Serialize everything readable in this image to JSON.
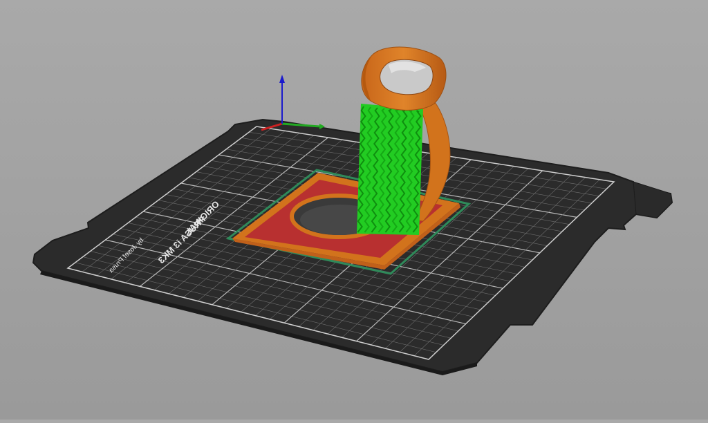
{
  "bed": {
    "brand_line1": "ORIGINAL",
    "brand_line2": "PRUSA i3 MK3",
    "brand_line3": "by Josef Prusa"
  },
  "colors": {
    "background": "#a3a3a3",
    "bed_sheet": "#2b2b2b",
    "grid_line": "#8a8a8a",
    "perimeter": "#d2731c",
    "infill": "#b83030",
    "support": "#22cc22",
    "skirt": "#2f8a5a",
    "axis_x": "#cc2222",
    "axis_y": "#22aa22",
    "axis_z": "#1a1acc"
  },
  "scene": {
    "view": "3D preview",
    "legend": [
      "perimeter",
      "infill",
      "support material",
      "skirt"
    ]
  }
}
